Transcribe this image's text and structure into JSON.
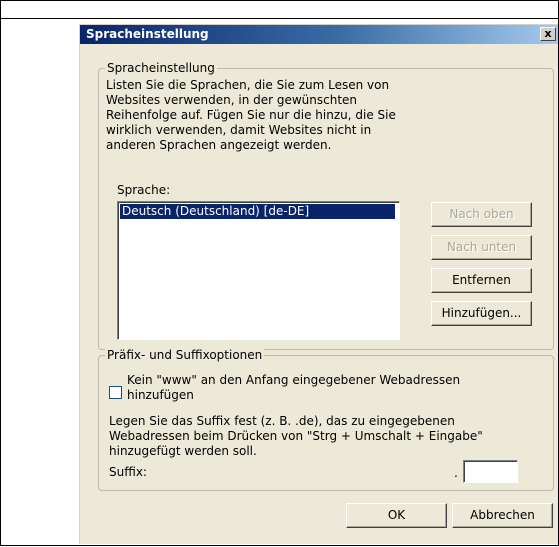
{
  "dialog": {
    "title": "Spracheinstellung",
    "close_label": "x"
  },
  "language_group": {
    "legend": "Spracheinstellung",
    "description": "Listen Sie die Sprachen, die Sie zum Lesen von Websites verwenden, in der gewünschten Reihenfolge auf. Fügen Sie nur die hinzu, die Sie wirklich verwenden, damit Websites nicht in anderen Sprachen angezeigt werden.",
    "list_label": "Sprache:",
    "languages": [
      "Deutsch (Deutschland) [de-DE]"
    ],
    "buttons": {
      "move_up": "Nach oben",
      "move_down": "Nach unten",
      "remove": "Entfernen",
      "add": "Hinzufügen..."
    }
  },
  "affix_group": {
    "legend": "Präfix- und Suffixoptionen",
    "checkbox_label": "Kein \"www\" an den Anfang eingegebener Webadressen hinzufügen",
    "checkbox_checked": false,
    "suffix_description": "Legen Sie das Suffix fest (z. B. .de), das zu eingegebenen Webadressen beim Drücken von \"Strg + Umschalt + Eingabe\" hinzugefügt werden soll.",
    "suffix_label": "Suffix:",
    "suffix_dot": ".",
    "suffix_value": ""
  },
  "footer": {
    "ok": "OK",
    "cancel": "Abbrechen"
  }
}
